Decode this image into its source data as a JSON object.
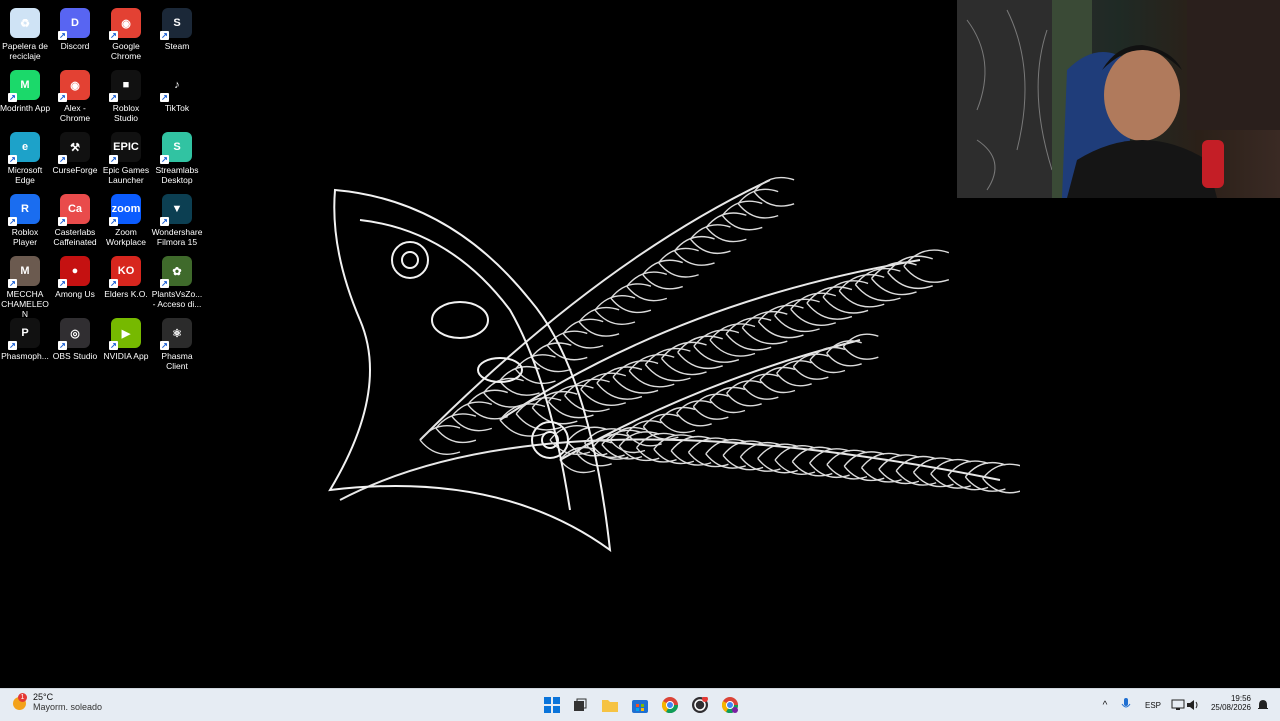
{
  "desktop": {
    "icons": [
      {
        "label": "Papelera de reciclaje",
        "icon": "recycle-bin-icon",
        "color": "#cfe3f5"
      },
      {
        "label": "Discord",
        "icon": "discord-icon",
        "color": "#5865f2"
      },
      {
        "label": "Google Chrome",
        "icon": "chrome-icon",
        "color": "#e34133"
      },
      {
        "label": "Steam",
        "icon": "steam-icon",
        "color": "#1b2838"
      },
      {
        "label": "Modrinth App",
        "icon": "modrinth-icon",
        "color": "#1bd96a"
      },
      {
        "label": "Alex - Chrome",
        "icon": "chrome-profile-icon",
        "color": "#e34133"
      },
      {
        "label": "Roblox Studio",
        "icon": "roblox-studio-icon",
        "color": "#111111"
      },
      {
        "label": "TikTok",
        "icon": "tiktok-icon",
        "color": "#000000"
      },
      {
        "label": "Microsoft Edge",
        "icon": "edge-icon",
        "color": "#1da2c9"
      },
      {
        "label": "CurseForge",
        "icon": "curseforge-icon",
        "color": "#111111"
      },
      {
        "label": "Epic Games Launcher",
        "icon": "epic-games-icon",
        "color": "#111111"
      },
      {
        "label": "Streamlabs Desktop",
        "icon": "streamlabs-icon",
        "color": "#31c3a2"
      },
      {
        "label": "Roblox Player",
        "icon": "roblox-player-icon",
        "color": "#1a6df0"
      },
      {
        "label": "Casterlabs Caffeinated",
        "icon": "casterlabs-icon",
        "color": "#e94b4b"
      },
      {
        "label": "Zoom Workplace",
        "icon": "zoom-icon",
        "color": "#0b5cff"
      },
      {
        "label": "Wondershare Filmora 15",
        "icon": "filmora-icon",
        "color": "#0c3f52"
      },
      {
        "label": "MECCHA CHAMELEON",
        "icon": "meccha-chameleon-icon",
        "color": "#6b5a4f"
      },
      {
        "label": "Among Us",
        "icon": "among-us-icon",
        "color": "#c51111"
      },
      {
        "label": "Elders K.O.",
        "icon": "elders-ko-icon",
        "color": "#d7261e"
      },
      {
        "label": "PlantsVsZo... - Acceso di...",
        "icon": "plants-vs-zombies-icon",
        "color": "#3f6a2b"
      },
      {
        "label": "Phasmoph...",
        "icon": "phasmophobia-icon",
        "color": "#111111"
      },
      {
        "label": "OBS Studio",
        "icon": "obs-icon",
        "color": "#302e31"
      },
      {
        "label": "NVIDIA App",
        "icon": "nvidia-icon",
        "color": "#76b900"
      },
      {
        "label": "Phasma Client",
        "icon": "phasma-client-icon",
        "color": "#2b2b2b"
      }
    ],
    "icon_glyphs": [
      "♻",
      "D",
      "◉",
      "S",
      "M",
      "◉",
      "■",
      "♪",
      "e",
      "⚒",
      "EPIC",
      "S",
      "R",
      "Ca",
      "zoom",
      "▼",
      "M",
      "●",
      "KO",
      "✿",
      "P",
      "◎",
      "▶",
      "⚛"
    ]
  },
  "taskbar": {
    "weather": {
      "temp": "25°C",
      "desc": "Mayorm. soleado",
      "badge": "1"
    },
    "pinned": [
      "start-button",
      "task-view-button",
      "file-explorer-button",
      "microsoft-store-button",
      "chrome-button",
      "obs-button",
      "chrome-alt-button"
    ],
    "tray": {
      "language": "ESP",
      "time": "19:56",
      "date": "25/08/2026"
    },
    "accent": "#0067c0"
  }
}
